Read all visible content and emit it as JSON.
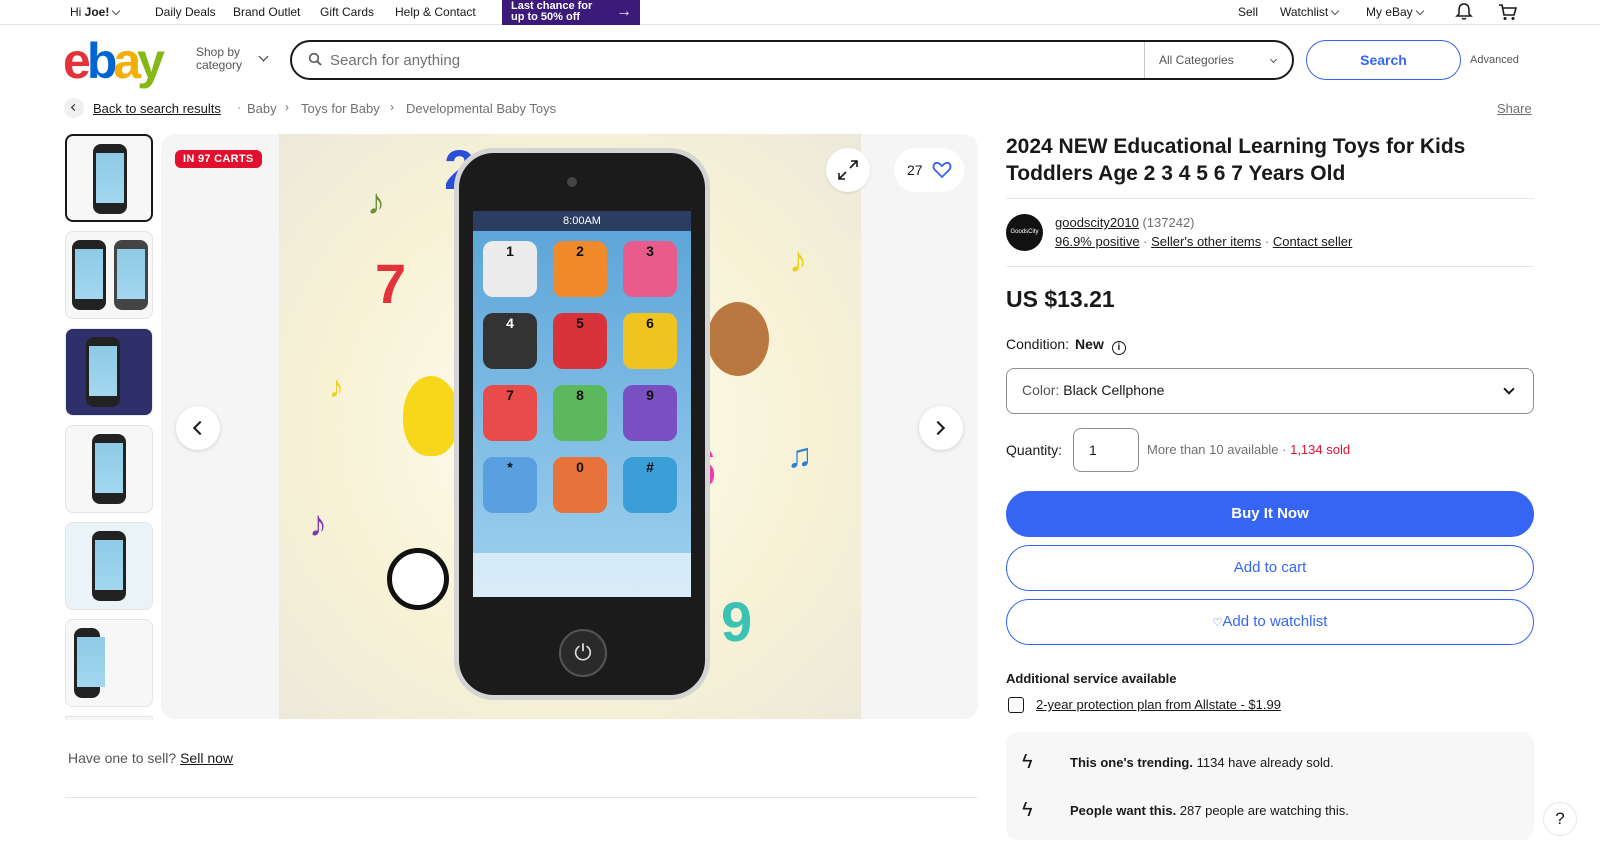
{
  "topbar": {
    "greeting_prefix": "Hi ",
    "user": "Joe!",
    "links": [
      "Daily Deals",
      "Brand Outlet",
      "Gift Cards",
      "Help & Contact"
    ],
    "promo_line1": "Last chance for",
    "promo_line2": "up to 50% off",
    "sell": "Sell",
    "watchlist": "Watchlist",
    "my_ebay": "My eBay"
  },
  "header": {
    "logo": [
      "e",
      "b",
      "a",
      "y"
    ],
    "shop_by_line1": "Shop by",
    "shop_by_line2": "category",
    "search_placeholder": "Search for anything",
    "category": "All Categories",
    "search_button": "Search",
    "advanced": "Advanced"
  },
  "breadcrumb": {
    "back": "Back to search results",
    "items": [
      "Baby",
      "Toys for Baby",
      "Developmental Baby Toys"
    ],
    "share": "Share"
  },
  "gallery": {
    "badge": "IN 97 CARTS",
    "watch_count": "27",
    "phone_time": "8:00AM",
    "keys": [
      "1",
      "2",
      "3",
      "4",
      "5",
      "6",
      "7",
      "8",
      "9",
      "*",
      "0",
      "#"
    ],
    "deco_numbers": [
      "2",
      "7",
      "6",
      "9"
    ]
  },
  "sell_prompt": {
    "text": "Have one to sell? ",
    "link": "Sell now"
  },
  "product": {
    "title": "2024 NEW Educational Learning Toys for Kids Toddlers Age 2 3 4 5 6 7 Years Old",
    "seller": {
      "logo_text": "GoodsCity",
      "name": "goodscity2010",
      "feedback_count": "(137242)",
      "positive": "96.9% positive",
      "other_items": "Seller's other items",
      "contact": "Contact seller"
    },
    "price": "US $13.21",
    "condition_label": "Condition:",
    "condition_value": "New",
    "variant_label": "Color: ",
    "variant_value": "Black Cellphone",
    "quantity_label": "Quantity:",
    "quantity_value": "1",
    "availability": "More than 10 available · ",
    "sold": "1,134 sold",
    "buy_now": "Buy It Now",
    "add_to_cart": "Add to cart",
    "add_to_watchlist": "Add to watchlist",
    "additional_service": "Additional service available",
    "protection_plan": "2-year protection plan from Allstate - $1.99",
    "trending": [
      {
        "bold": "This one's trending.",
        "text": " 1134 have already sold."
      },
      {
        "bold": "People want this.",
        "text": " 287 people are watching this."
      }
    ]
  },
  "help": "?",
  "colors": {
    "accent": "#3665f3",
    "sale_red": "#e0102e",
    "promo_purple": "#3b1a7a"
  }
}
